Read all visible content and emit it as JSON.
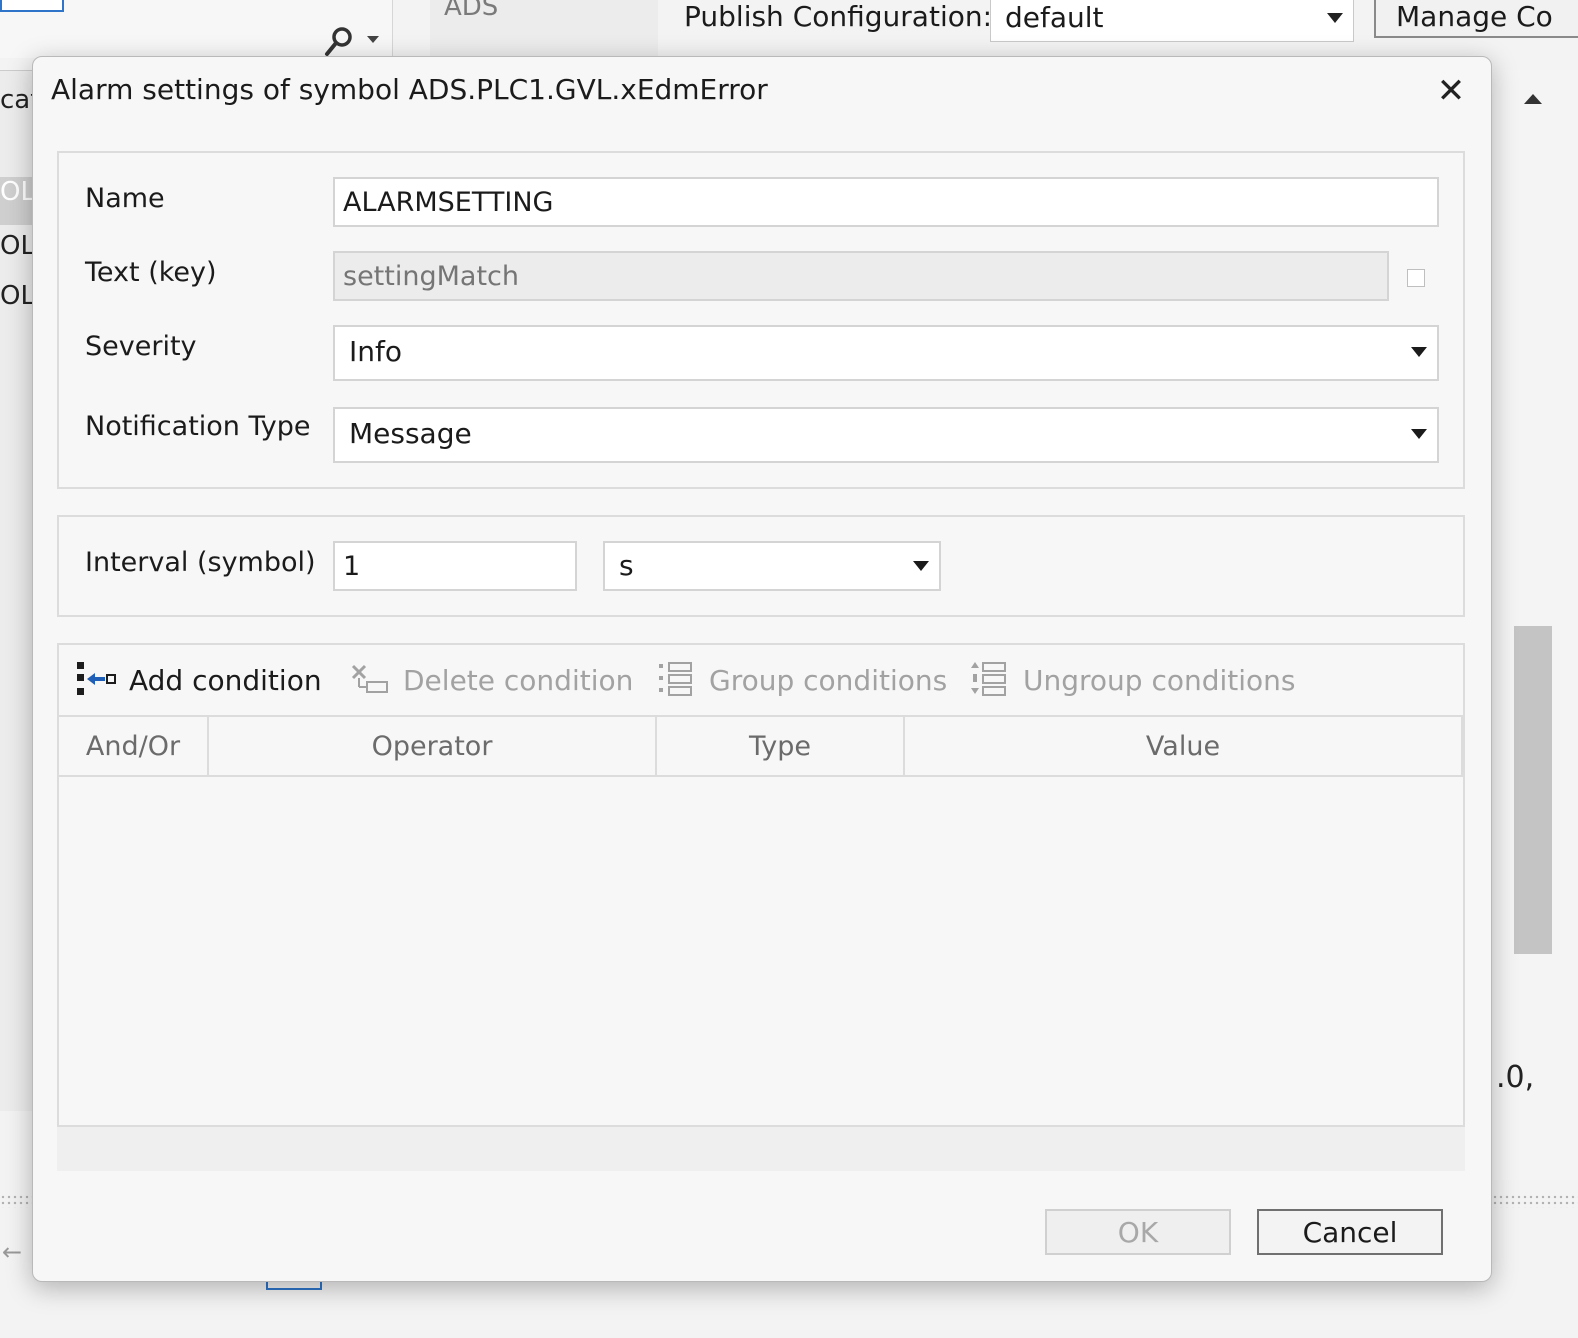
{
  "background": {
    "ads_label": "ADS",
    "publish_label": "Publish Configuration:",
    "publish_value": "default",
    "manage_button": "Manage Co",
    "left_rows": [
      "cat",
      "OL",
      "OL",
      "OL"
    ],
    "right_text": ".0,"
  },
  "dialog": {
    "title": "Alarm settings of symbol ADS.PLC1.GVL.xEdmError",
    "close_glyph": "✕",
    "name": {
      "label": "Name",
      "value": "ALARMSETTING"
    },
    "text_key": {
      "label": "Text (key)",
      "placeholder": "settingMatch"
    },
    "severity": {
      "label": "Severity",
      "value": "Info"
    },
    "notification": {
      "label": "Notification Type",
      "value": "Message"
    },
    "interval": {
      "label": "Interval (symbol)",
      "value": "1",
      "unit": "s"
    },
    "toolbar": {
      "add": "Add condition",
      "delete": "Delete condition",
      "group": "Group conditions",
      "ungroup": "Ungroup conditions"
    },
    "columns": [
      "And/Or",
      "Operator",
      "Type",
      "Value"
    ],
    "buttons": {
      "ok": "OK",
      "cancel": "Cancel"
    }
  },
  "colors": {
    "accent": "#2e74c9",
    "icon_dark": "#1d1d1d",
    "icon_blue": "#1f5fb7"
  }
}
